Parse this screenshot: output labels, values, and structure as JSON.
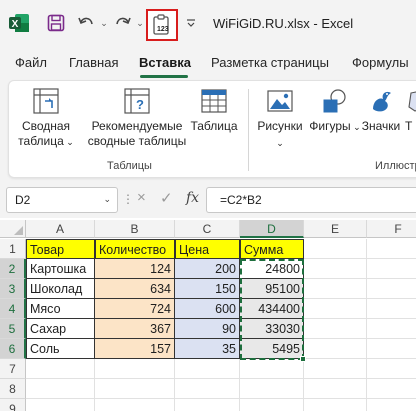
{
  "titlebar": {
    "app_icon": "excel-logo-icon",
    "save_icon": "save-icon",
    "undo_icon": "undo-icon",
    "redo_icon": "redo-icon",
    "paste_values_icon": "paste-values-icon",
    "paste_values_badge": "123",
    "doc_title": "WiFiGiD.RU.xlsx  -  Excel",
    "highlight_color": "#d81d1d"
  },
  "tabs": [
    {
      "label": "Файл"
    },
    {
      "label": "Главная"
    },
    {
      "label": "Вставка"
    },
    {
      "label": "Разметка страницы"
    },
    {
      "label": "Формулы"
    }
  ],
  "ribbon": {
    "tables_group": {
      "pivot_line1": "Сводная",
      "pivot_line2": "таблица",
      "recommended_line1": "Рекомендуемые",
      "recommended_line2": "сводные таблицы",
      "table_label": "Таблица",
      "group_label": "Таблицы"
    },
    "illustrations_group": {
      "pictures_label": "Рисунки",
      "shapes_label": "Фигуры",
      "icons_label": "Значки",
      "group_label": "Иллюстр"
    }
  },
  "formula_bar": {
    "name_box": "D2",
    "formula": "=C2*B2",
    "cancel_icon": "×",
    "enter_icon": "✓",
    "fx_label": "fx"
  },
  "grid": {
    "columns": [
      "A",
      "B",
      "C",
      "D",
      "E",
      "F"
    ],
    "rows": [
      "1",
      "2",
      "3",
      "4",
      "5",
      "6",
      "7",
      "8",
      "9"
    ],
    "headers": [
      "Товар",
      "Количество",
      "Цена",
      "Сумма"
    ],
    "data": [
      [
        "Картошка",
        "124",
        "200",
        "24800"
      ],
      [
        "Шоколад",
        "634",
        "150",
        "95100"
      ],
      [
        "Мясо",
        "724",
        "600",
        "434400"
      ],
      [
        "Сахар",
        "367",
        "90",
        "33030"
      ],
      [
        "Соль",
        "157",
        "35",
        "5495"
      ]
    ],
    "colors": {
      "header_fill": "#ffff00",
      "quantity_fill": "#fce4c7",
      "price_fill": "#dbe1f2",
      "selection": "#217346"
    }
  }
}
